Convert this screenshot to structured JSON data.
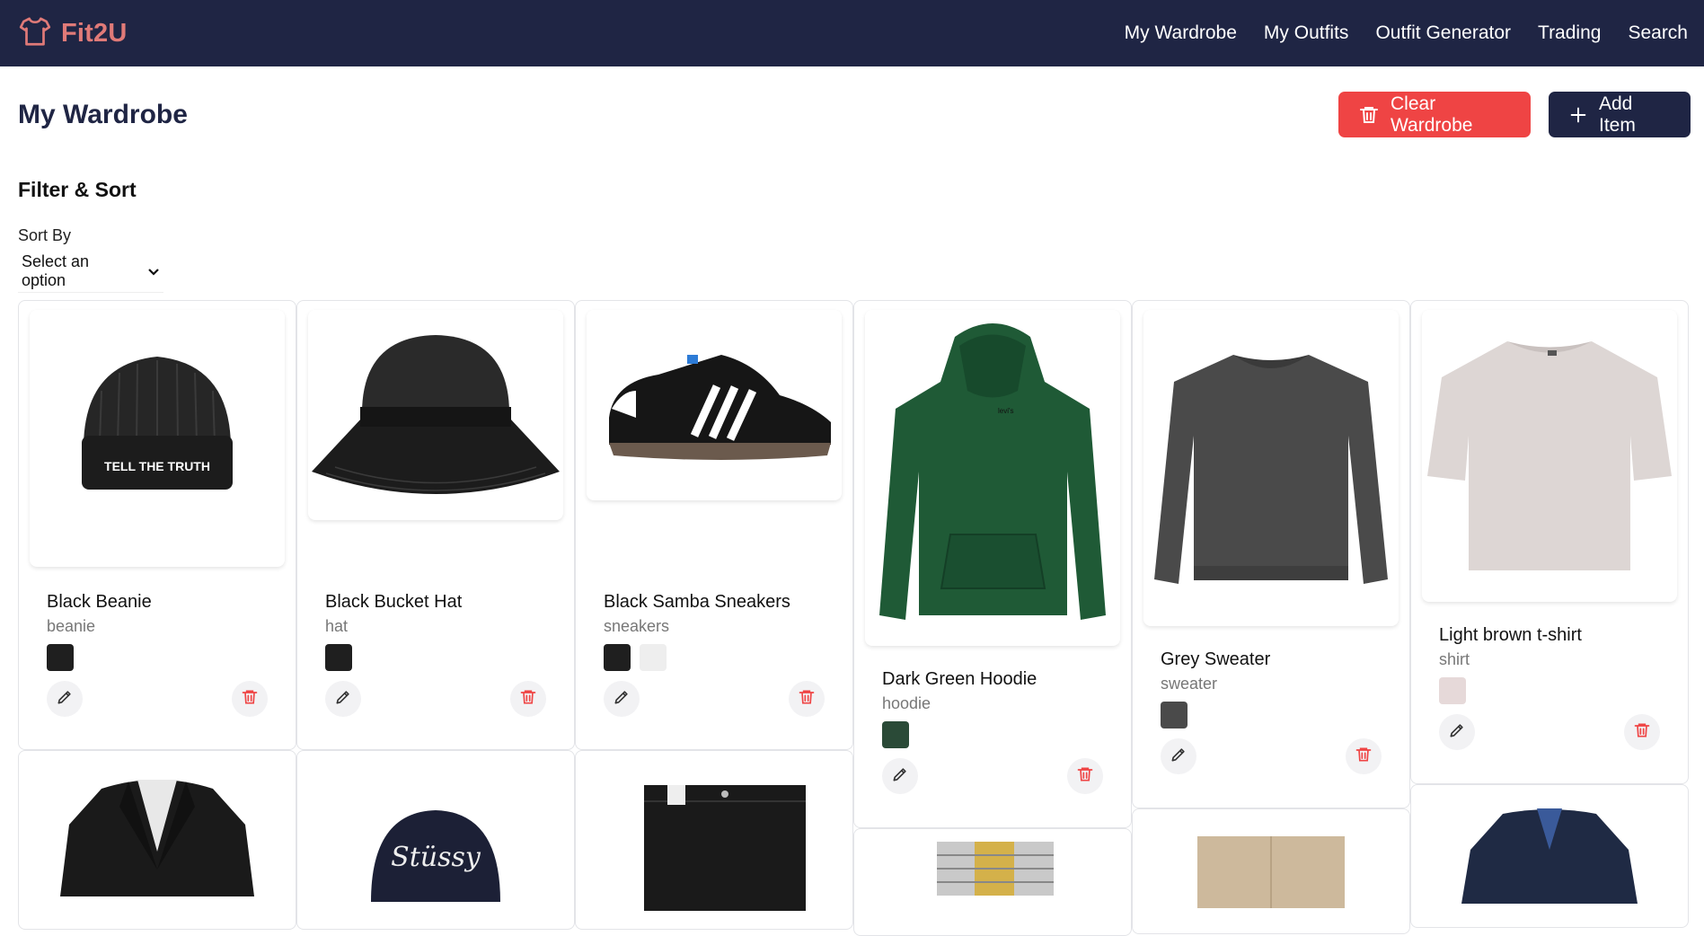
{
  "brand": {
    "name": "Fit2U",
    "color": "#e07a78"
  },
  "nav": {
    "items": [
      "My Wardrobe",
      "My Outfits",
      "Outfit Generator",
      "Trading",
      "Search"
    ]
  },
  "page": {
    "title": "My Wardrobe",
    "clear_label": "Clear Wardrobe",
    "add_label": "Add Item"
  },
  "filter": {
    "title": "Filter & Sort",
    "sort_label": "Sort By",
    "sort_value": "Select an option"
  },
  "items": [
    {
      "name": "Black Beanie",
      "type": "beanie",
      "colors": [
        "#1f1f1f"
      ],
      "icon": "beanie-icon"
    },
    {
      "name": "Black Bucket Hat",
      "type": "hat",
      "colors": [
        "#1f1f1f"
      ],
      "icon": "bucket-hat-icon"
    },
    {
      "name": "Black Samba Sneakers",
      "type": "sneakers",
      "colors": [
        "#1f1f1f",
        "#eeeeee"
      ],
      "icon": "sneaker-icon"
    },
    {
      "name": "Dark Green Hoodie",
      "type": "hoodie",
      "colors": [
        "#2a4a37"
      ],
      "icon": "hoodie-icon"
    },
    {
      "name": "Grey Sweater",
      "type": "sweater",
      "colors": [
        "#4a4a4a"
      ],
      "icon": "sweater-icon"
    },
    {
      "name": "Light brown t-shirt",
      "type": "shirt",
      "colors": [
        "#e6d9d9"
      ],
      "icon": "tshirt-icon"
    }
  ],
  "row2_icons": [
    "blazer-icon",
    "cap-icon",
    "jeans-icon",
    "watch-icon",
    "shorts-icon",
    "navy-blazer-icon"
  ]
}
